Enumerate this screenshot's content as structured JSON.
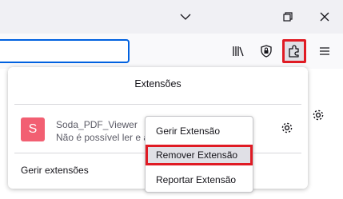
{
  "panel": {
    "title": "Extensões",
    "manage_label": "Gerir extensões"
  },
  "extension": {
    "icon_letter": "S",
    "name": "Soda_PDF_Viewer",
    "status": "Não é possível ler e al",
    "icon_color": "#f25f72"
  },
  "context_menu": {
    "items": [
      "Gerir Extensão",
      "Remover Extensão",
      "Reportar Extensão"
    ],
    "highlighted": "Remover Extensão"
  },
  "highlight_color": "#e01b24",
  "icons": [
    "chevron-down-icon",
    "restore-icon",
    "close-icon",
    "library-icon",
    "shield-icon",
    "extensions-icon",
    "menu-icon",
    "gear-icon"
  ]
}
